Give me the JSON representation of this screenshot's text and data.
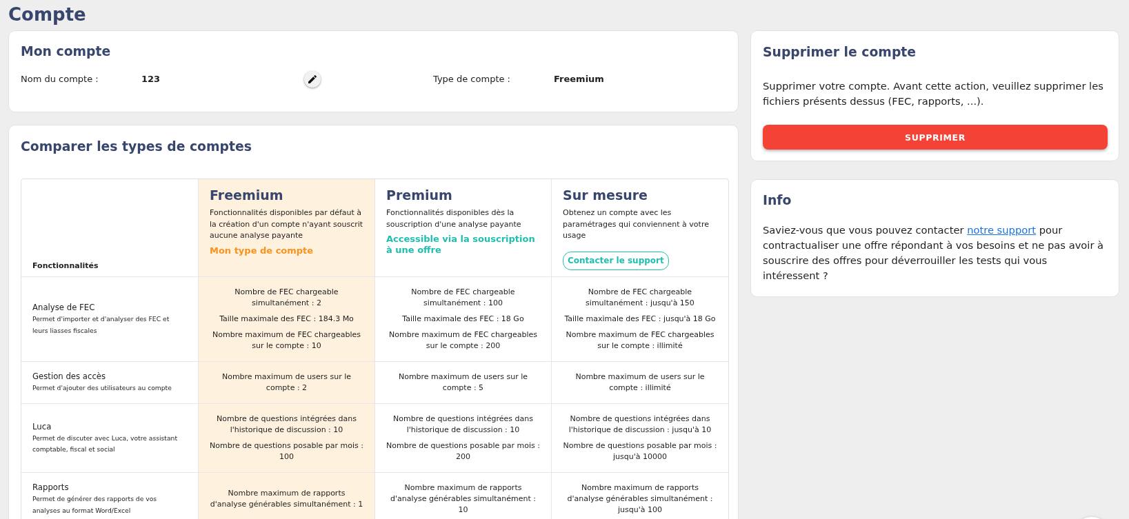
{
  "page": {
    "title": "Compte"
  },
  "account_card": {
    "title": "Mon compte",
    "fields": [
      {
        "label": "Nom du compte :",
        "value": "123",
        "editable": true
      },
      {
        "label": "Type de compte :",
        "value": "Freemium",
        "editable": false
      }
    ]
  },
  "compare_card": {
    "title": "Comparer les types de comptes",
    "table": {
      "feature_header": "Fonctionnalités",
      "plans": [
        {
          "name": "Freemium",
          "description": "Fonctionnalités disponibles par défaut à la création d'un compte n'ayant souscrit aucune analyse payante",
          "selected": true,
          "action": {
            "kind": "current",
            "label": "Mon type de compte"
          }
        },
        {
          "name": "Premium",
          "description": "Fonctionnalités disponibles dès la souscription d'une analyse payante",
          "selected": false,
          "action": {
            "kind": "info",
            "label": "Accessible via la souscription à une offre"
          }
        },
        {
          "name": "Sur mesure",
          "description": "Obtenez un compte avec les paramétrages qui conviennent à votre usage",
          "selected": false,
          "action": {
            "kind": "button",
            "label": "Contacter le support"
          }
        }
      ],
      "rows": [
        {
          "feature": "Analyse de FEC",
          "description": "Permet d'importer et d'analyser des FEC et leurs liasses fiscales",
          "values": [
            [
              "Nombre de FEC chargeable simultanément : 2",
              "Taille maximale des FEC : 184.3 Mo",
              "Nombre maximum de FEC chargeables sur le compte : 10"
            ],
            [
              "Nombre de FEC chargeable simultanément : 100",
              "Taille maximale des FEC : 18 Go",
              "Nombre maximum de FEC chargeables sur le compte : 200"
            ],
            [
              "Nombre de FEC chargeable simultanément : jusqu'à 150",
              "Taille maximale des FEC : jusqu'à 18 Go",
              "Nombre maximum de FEC chargeables sur le compte : illimité"
            ]
          ]
        },
        {
          "feature": "Gestion des accès",
          "description": "Permet d'ajouter des utilisateurs au compte",
          "values": [
            [
              "Nombre maximum de users sur le compte : 2"
            ],
            [
              "Nombre maximum de users sur le compte : 5"
            ],
            [
              "Nombre maximum de users sur le compte : illimité"
            ]
          ]
        },
        {
          "feature": "Luca",
          "description": "Permet de discuter avec Luca, votre assistant comptable, fiscal et social",
          "values": [
            [
              "Nombre de questions intégrées dans l'historique de discussion : 10",
              "Nombre de questions posable par mois : 100"
            ],
            [
              "Nombre de questions intégrées dans l'historique de discussion : 10",
              "Nombre de questions posable par mois : 200"
            ],
            [
              "Nombre de questions intégrées dans l'historique de discussion : jusqu'à 10",
              "Nombre de questions posable par mois : jusqu'à 10000"
            ]
          ]
        },
        {
          "feature": "Rapports",
          "description": "Permet de générer des rapports de vos analyses au format Word/Excel",
          "values": [
            [
              "Nombre maximum de rapports d'analyse générables simultanément : 1"
            ],
            [
              "Nombre maximum de rapports d'analyse générables simultanément : 10"
            ],
            [
              "Nombre maximum de rapports d'analyse générables simultanément : jusqu'à 100"
            ]
          ]
        }
      ]
    }
  },
  "delete_card": {
    "title": "Supprimer le compte",
    "text": "Supprimer votre compte. Avant cette action, veuillez supprimer les fichiers présents dessus (FEC, rapports, ...).",
    "button": "SUPPRIMER"
  },
  "info_card": {
    "title": "Info",
    "text_before": "Saviez-vous que vous pouvez contacter",
    "link": "notre support",
    "text_after": "pour contractualiser une offre répondant à vos besoins et ne pas avoir à souscrire des offres pour déverrouiller les tests qui vous intéressent ?"
  }
}
